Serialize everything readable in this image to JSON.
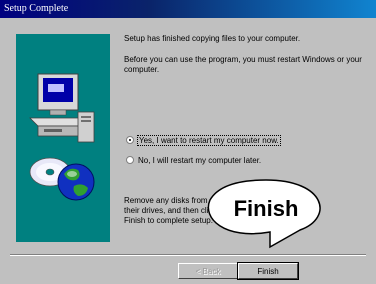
{
  "window": {
    "title": "Setup Complete"
  },
  "messages": {
    "line1": "Setup has finished copying files to your computer.",
    "line2": "Before you can use the program, you must restart Windows or your computer.",
    "remove": "Remove any disks from their drives, and then click Finish to complete setup."
  },
  "options": [
    {
      "label": "Yes, I want to restart my computer now.",
      "selected": true
    },
    {
      "label": "No, I will restart my computer later.",
      "selected": false
    }
  ],
  "buttons": {
    "back": "< Back",
    "finish": "Finish"
  },
  "callout": {
    "text": "Finish"
  },
  "colors": {
    "titlebar": "#000080",
    "panel": "#008080",
    "face": "#c0c0c0"
  },
  "icons": [
    "computer-icon",
    "globe-cd-icon"
  ]
}
